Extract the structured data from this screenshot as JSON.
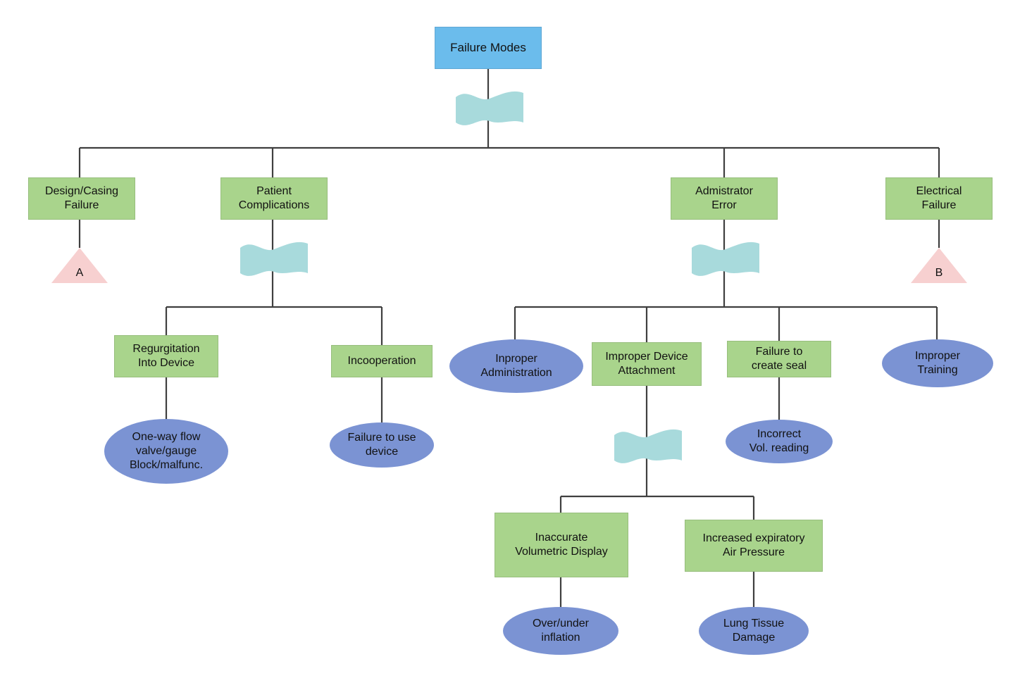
{
  "diagram": {
    "type": "fault-tree",
    "title": "Failure Modes",
    "colors": {
      "top_event": "#6BBCEC",
      "intermediate_event": "#A9D48C",
      "basic_event": "#7B93D3",
      "transfer_symbol": "#F7D0D0",
      "gate_banner": "#A8DADC",
      "connector_line": "#3F3F3F",
      "background": "#FFFFFF",
      "text": "#111111"
    },
    "legend_semantics": {
      "rectangle_blue": "top event",
      "rectangle_green": "intermediate event",
      "ellipse_blue": "basic event",
      "triangle_pink": "transfer symbol",
      "wavy_banner_teal": "logic gate"
    }
  },
  "nodes": {
    "top_event": {
      "label": "Failure Modes",
      "shape": "rect",
      "kind": "top"
    },
    "level1": [
      {
        "id": "design-casing-failure",
        "label": "Design/Casing\nFailure",
        "shape": "rect",
        "kind": "gate"
      },
      {
        "id": "patient-complications",
        "label": "Patient\nComplications",
        "shape": "rect",
        "kind": "gate"
      },
      {
        "id": "admistrator-error",
        "label": "Admistrator\nError",
        "shape": "rect",
        "kind": "gate"
      },
      {
        "id": "electrical-failure",
        "label": "Electrical\nFailure",
        "shape": "rect",
        "kind": "gate"
      }
    ],
    "transfers": [
      {
        "id": "transfer-a",
        "label": "A",
        "shape": "triangle",
        "parent": "design-casing-failure"
      },
      {
        "id": "transfer-b",
        "label": "B",
        "shape": "triangle",
        "parent": "electrical-failure"
      }
    ],
    "level2": [
      {
        "id": "regurgitation-into-device",
        "label": "Regurgitation\nInto Device",
        "shape": "rect",
        "kind": "gate",
        "parent": "patient-complications"
      },
      {
        "id": "incooperation",
        "label": "Incooperation",
        "shape": "rect",
        "kind": "gate",
        "parent": "patient-complications"
      },
      {
        "id": "inproper-administration",
        "label": "Inproper\nAdministration",
        "shape": "ellipse",
        "kind": "basic",
        "parent": "admistrator-error"
      },
      {
        "id": "improper-device-attachment",
        "label": "Improper Device\nAttachment",
        "shape": "rect",
        "kind": "gate",
        "parent": "admistrator-error"
      },
      {
        "id": "failure-to-create-seal",
        "label": "Failure to\ncreate seal",
        "shape": "rect",
        "kind": "gate",
        "parent": "admistrator-error"
      },
      {
        "id": "improper-training",
        "label": "Improper\nTraining",
        "shape": "ellipse",
        "kind": "basic",
        "parent": "admistrator-error"
      }
    ],
    "level3": [
      {
        "id": "one-way-flow-valve",
        "label": "One-way flow\nvalve/gauge\nBlock/malfunc.",
        "shape": "ellipse",
        "kind": "basic",
        "parent": "regurgitation-into-device"
      },
      {
        "id": "failure-to-use-device",
        "label": "Failure to use\ndevice",
        "shape": "ellipse",
        "kind": "basic",
        "parent": "incooperation"
      },
      {
        "id": "incorrect-vol-reading",
        "label": "Incorrect\nVol. reading",
        "shape": "ellipse",
        "kind": "basic",
        "parent": "failure-to-create-seal"
      },
      {
        "id": "inaccurate-volumetric-display",
        "label": "Inaccurate\nVolumetric Display",
        "shape": "rect",
        "kind": "gate",
        "parent": "improper-device-attachment"
      },
      {
        "id": "increased-expiratory-air-pressure",
        "label": "Increased expiratory\nAir Pressure",
        "shape": "rect",
        "kind": "gate",
        "parent": "improper-device-attachment"
      }
    ],
    "level4": [
      {
        "id": "over-under-inflation",
        "label": "Over/under\ninflation",
        "shape": "ellipse",
        "kind": "basic",
        "parent": "inaccurate-volumetric-display"
      },
      {
        "id": "lung-tissue-damage",
        "label": "Lung Tissue\nDamage",
        "shape": "ellipse",
        "kind": "basic",
        "parent": "increased-expiratory-air-pressure"
      }
    ],
    "gates": [
      {
        "id": "gate-top",
        "under": "Failure Modes"
      },
      {
        "id": "gate-patient-complications",
        "under": "Patient Complications"
      },
      {
        "id": "gate-admistrator-error",
        "under": "Admistrator Error"
      },
      {
        "id": "gate-improper-device-attachment",
        "under": "Improper Device Attachment"
      }
    ]
  }
}
